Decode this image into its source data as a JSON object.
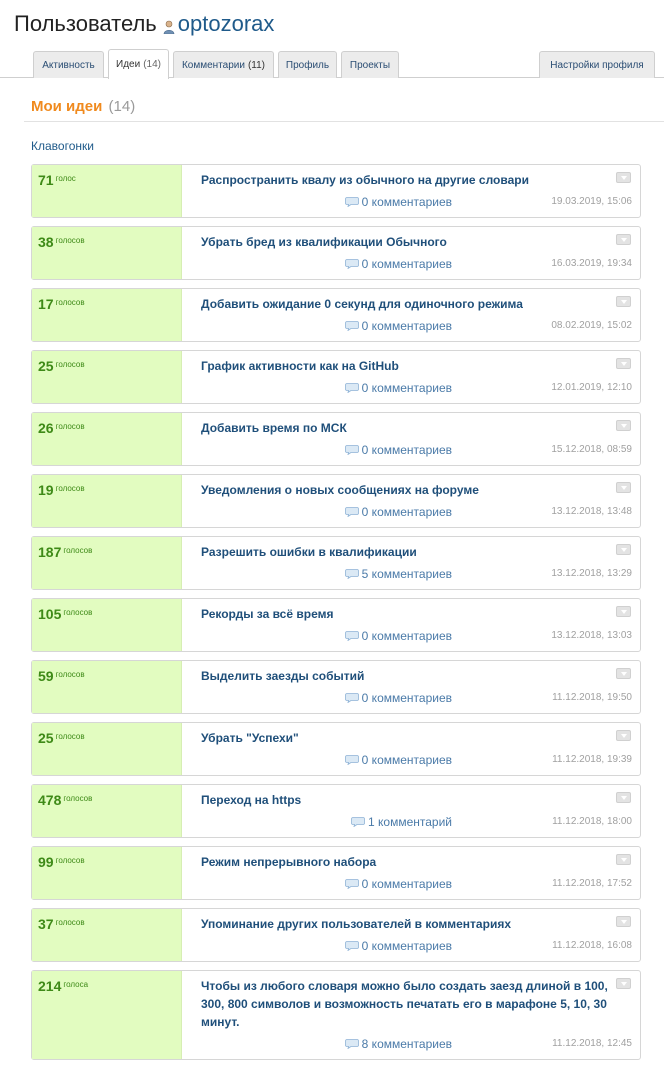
{
  "header": {
    "title": "Пользователь",
    "username": "optozorax"
  },
  "tabs": [
    {
      "label": "Активность",
      "count": ""
    },
    {
      "label": "Идеи",
      "count": "(14)"
    },
    {
      "label": "Комментарии",
      "count": "(11)"
    },
    {
      "label": "Профиль",
      "count": ""
    },
    {
      "label": "Проекты",
      "count": ""
    },
    {
      "label": "Настройки профиля",
      "count": ""
    }
  ],
  "section": {
    "title": "Мои идеи",
    "count": "(14)"
  },
  "group_label": "Клавогонки",
  "ideas": [
    {
      "votes": "71",
      "vote_word": "голос",
      "title": "Распространить квалу из обычного на другие словари",
      "comments": "0 комментариев",
      "date": "19.03.2019, 15:06"
    },
    {
      "votes": "38",
      "vote_word": "голосов",
      "title": "Убрать бред из квалификации Обычного",
      "comments": "0 комментариев",
      "date": "16.03.2019, 19:34"
    },
    {
      "votes": "17",
      "vote_word": "голосов",
      "title": "Добавить ожидание 0 секунд для одиночного режима",
      "comments": "0 комментариев",
      "date": "08.02.2019, 15:02"
    },
    {
      "votes": "25",
      "vote_word": "голосов",
      "title": "График активности как на GitHub",
      "comments": "0 комментариев",
      "date": "12.01.2019, 12:10"
    },
    {
      "votes": "26",
      "vote_word": "голосов",
      "title": "Добавить время по МСК",
      "comments": "0 комментариев",
      "date": "15.12.2018, 08:59"
    },
    {
      "votes": "19",
      "vote_word": "голосов",
      "title": "Уведомления о новых сообщениях на форуме",
      "comments": "0 комментариев",
      "date": "13.12.2018, 13:48"
    },
    {
      "votes": "187",
      "vote_word": "голосов",
      "title": "Разрешить ошибки в квалификации",
      "comments": "5 комментариев",
      "date": "13.12.2018, 13:29"
    },
    {
      "votes": "105",
      "vote_word": "голосов",
      "title": "Рекорды за всё время",
      "comments": "0 комментариев",
      "date": "13.12.2018, 13:03"
    },
    {
      "votes": "59",
      "vote_word": "голосов",
      "title": "Выделить заезды событий",
      "comments": "0 комментариев",
      "date": "11.12.2018, 19:50"
    },
    {
      "votes": "25",
      "vote_word": "голосов",
      "title": "Убрать \"Успехи\"",
      "comments": "0 комментариев",
      "date": "11.12.2018, 19:39"
    },
    {
      "votes": "478",
      "vote_word": "голосов",
      "title": "Переход на https",
      "comments": "1 комментарий",
      "date": "11.12.2018, 18:00"
    },
    {
      "votes": "99",
      "vote_word": "голосов",
      "title": "Режим непрерывного набора",
      "comments": "0 комментариев",
      "date": "11.12.2018, 17:52"
    },
    {
      "votes": "37",
      "vote_word": "голосов",
      "title": "Упоминание других пользователей в комментариях",
      "comments": "0 комментариев",
      "date": "11.12.2018, 16:08"
    },
    {
      "votes": "214",
      "vote_word": "голоса",
      "title": "Чтобы из любого словаря можно было создать заезд длиной в 100, 300, 800 символов и возможность печатать его в марафоне 5, 10, 30 минут.",
      "comments": "8 комментариев",
      "date": "11.12.2018, 12:45"
    }
  ]
}
